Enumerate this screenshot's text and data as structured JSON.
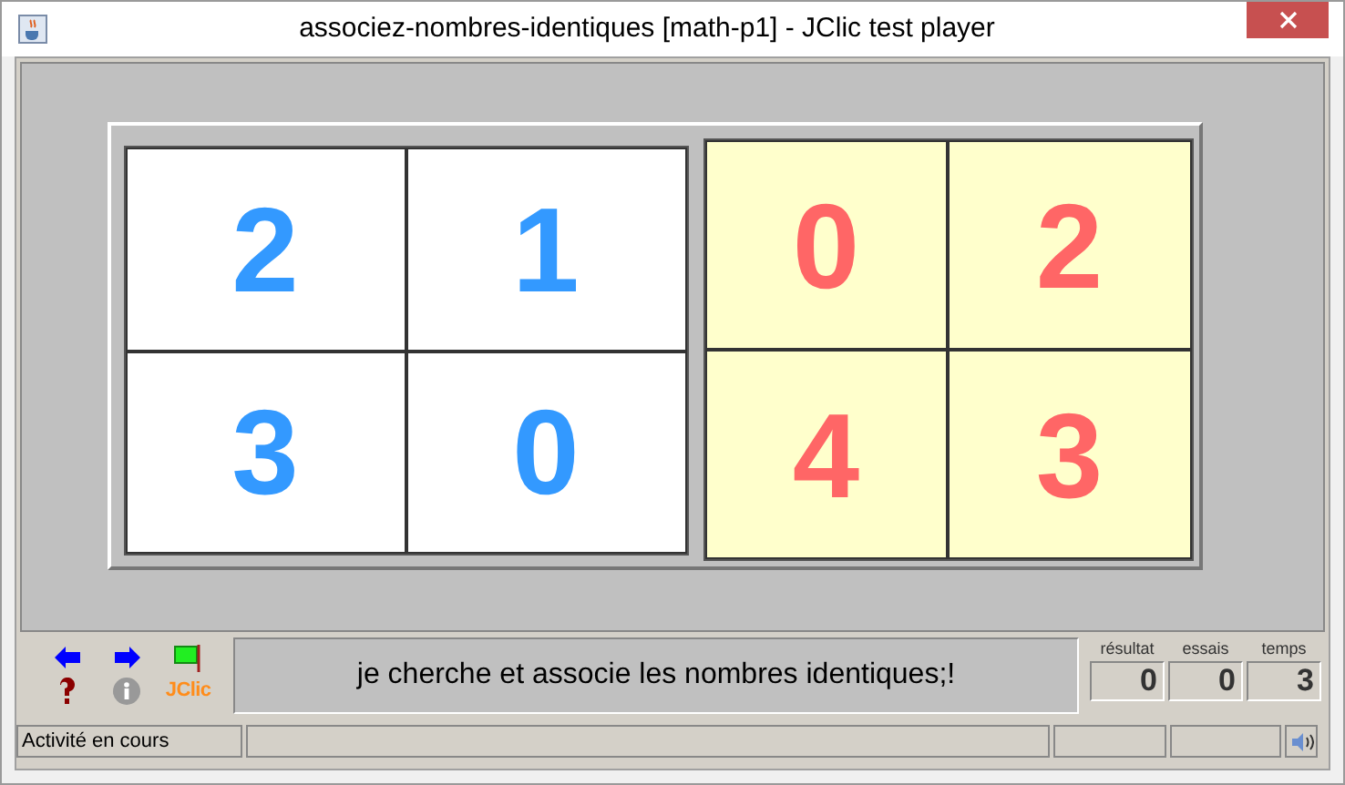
{
  "window": {
    "title": "associez-nombres-identiques [math-p1] - JClic test player"
  },
  "board": {
    "panels": [
      {
        "kind": "source",
        "cells": [
          "2",
          "1",
          "3",
          "0"
        ]
      },
      {
        "kind": "target",
        "cells": [
          "0",
          "2",
          "4",
          "3"
        ]
      }
    ]
  },
  "toolbar": {
    "logo": "JClic"
  },
  "message": "je cherche et associe les nombres identiques;!",
  "counters": [
    {
      "label": "résultat",
      "value": "0"
    },
    {
      "label": "essais",
      "value": "0"
    },
    {
      "label": "temps",
      "value": "3"
    }
  ],
  "status_bar": {
    "text": "Activité en cours"
  }
}
